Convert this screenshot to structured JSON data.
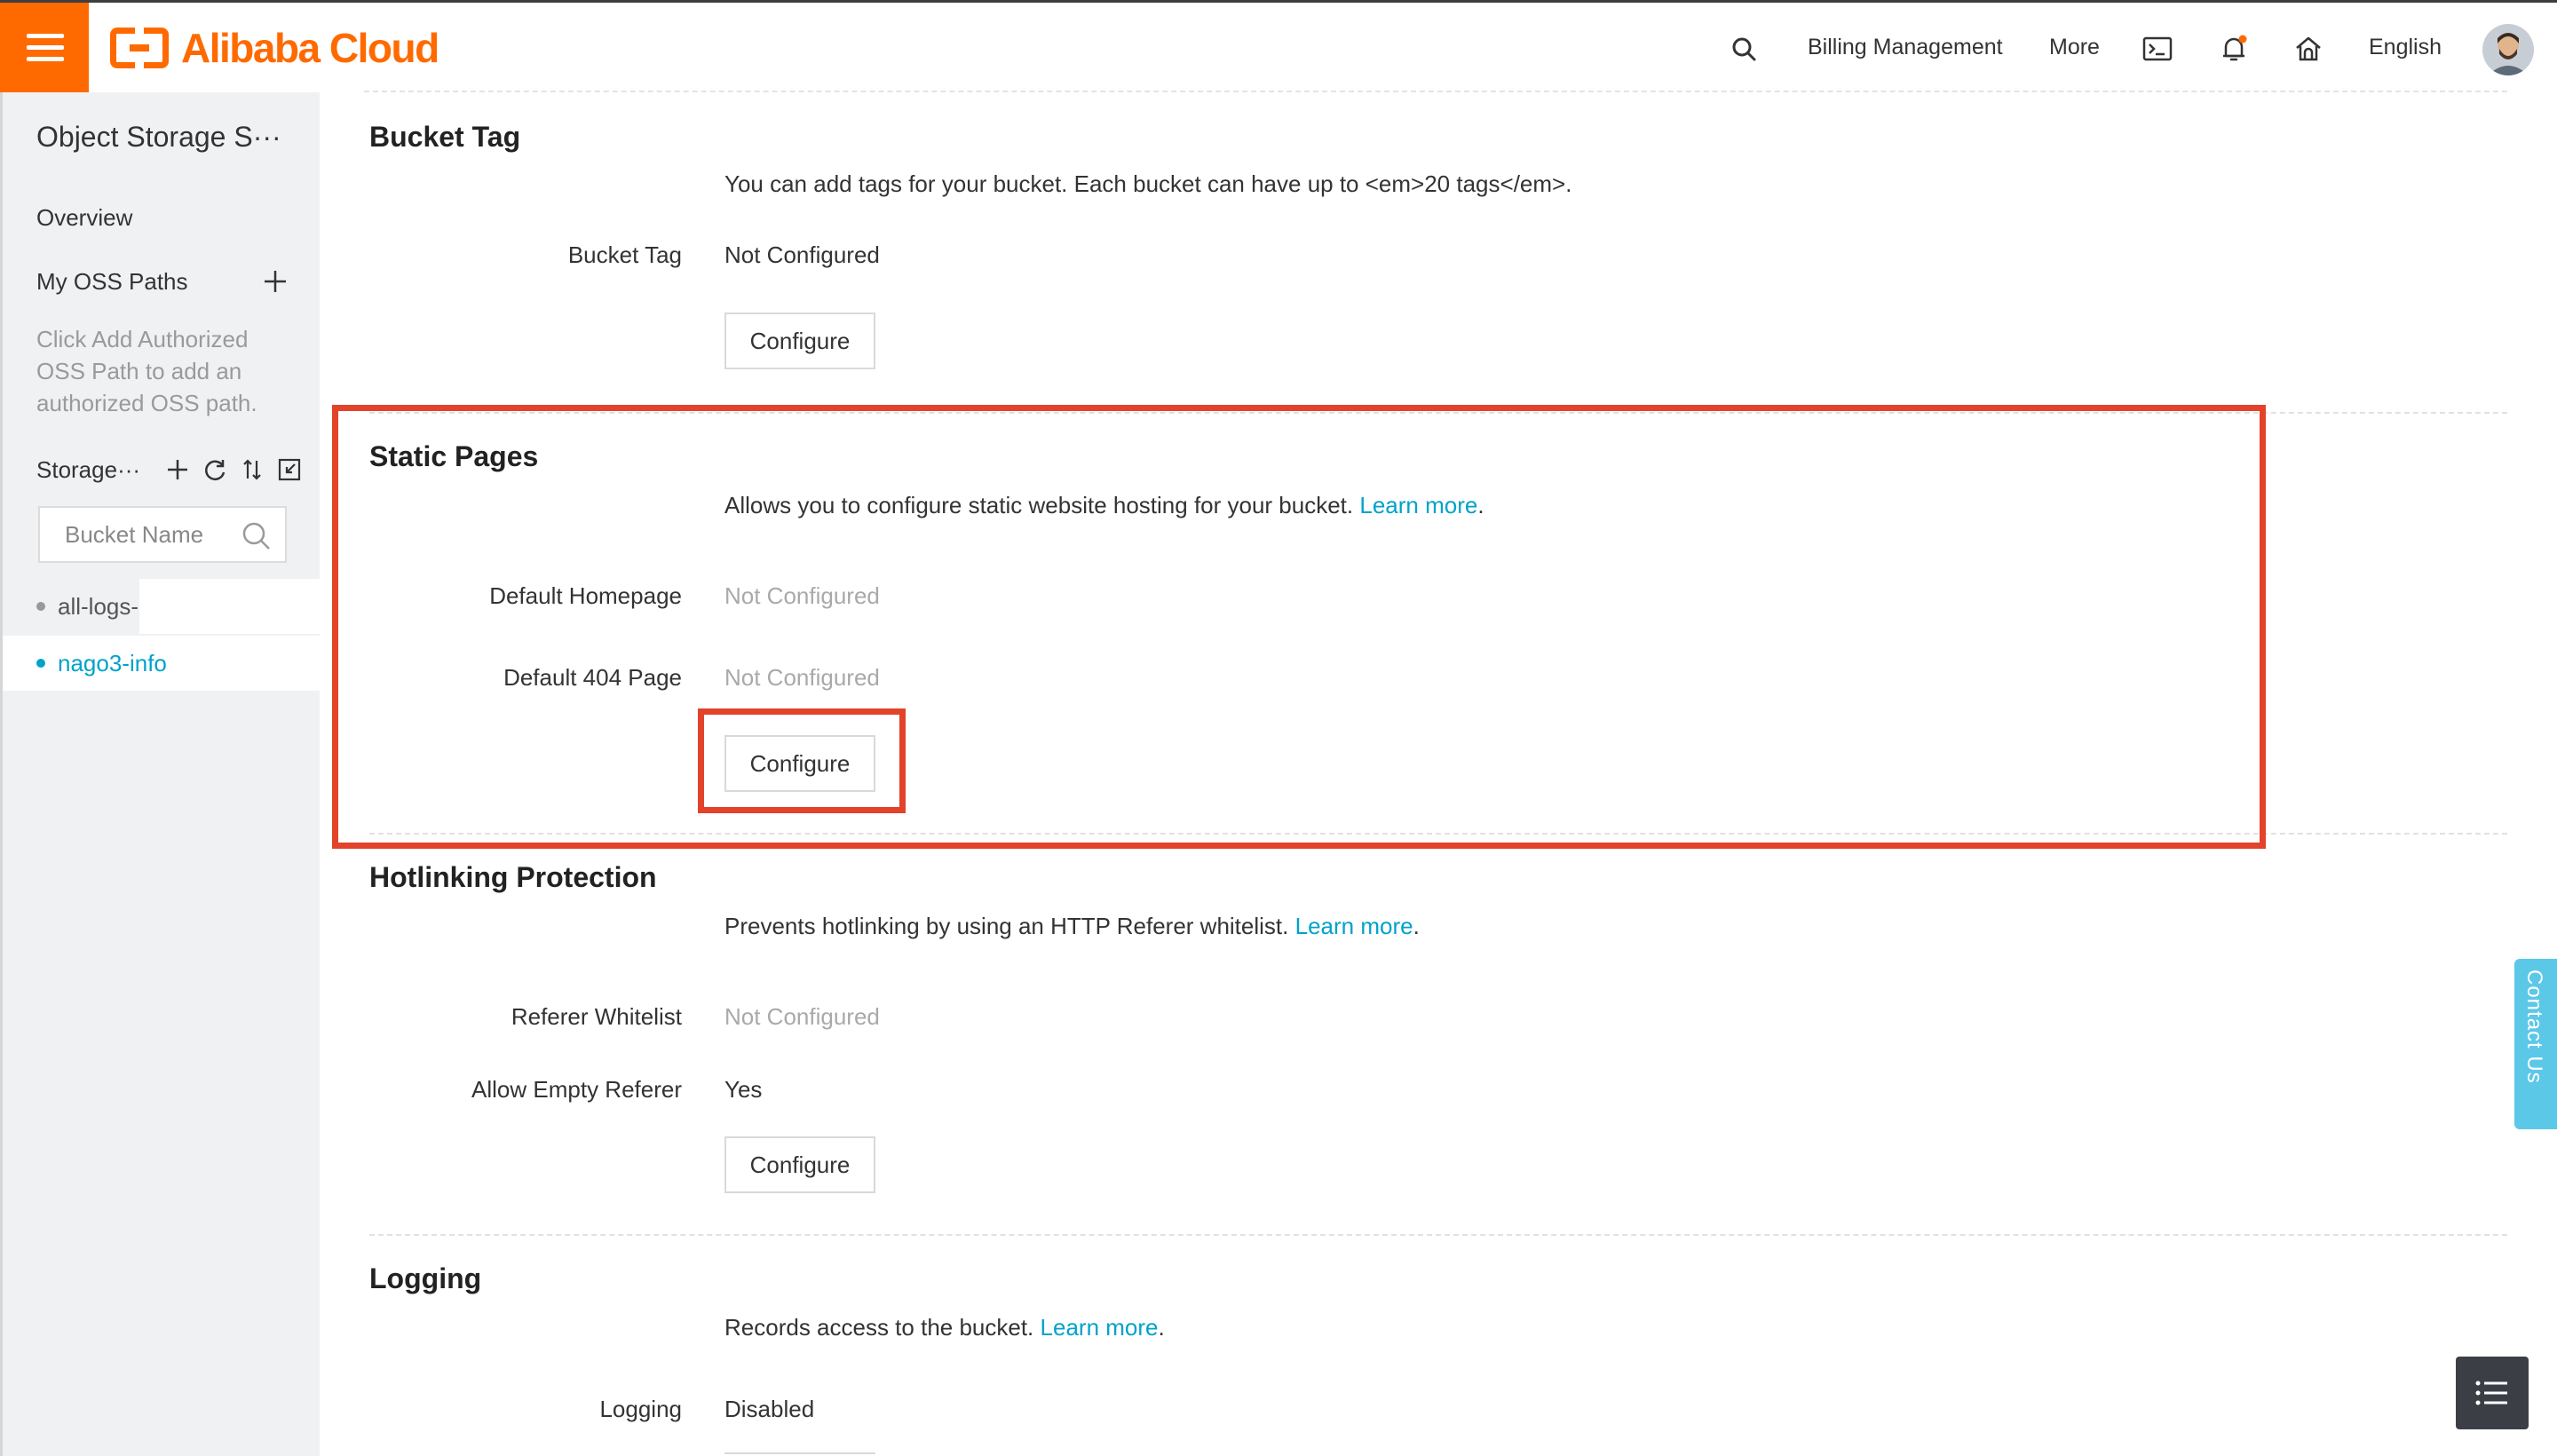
{
  "header": {
    "logo_text": "Alibaba Cloud",
    "nav": {
      "billing": "Billing Management",
      "more": "More",
      "language": "English"
    },
    "icons": [
      "menu-icon",
      "search-icon",
      "terminal-icon",
      "bell-icon",
      "home-icon"
    ],
    "accent_color": "#ff6a00"
  },
  "sidebar": {
    "title": "Object Storage S···",
    "overview": "Overview",
    "my_paths": "My OSS Paths",
    "hint": "Click Add Authorized OSS Path to add an authorized OSS path.",
    "storage_label": "Storage···",
    "search_placeholder": "Bucket Name",
    "buckets": [
      {
        "name": "all-logs-",
        "active": false
      },
      {
        "name": "nago3-info",
        "active": true
      }
    ]
  },
  "sections": {
    "bucket_tag": {
      "title": "Bucket Tag",
      "desc": "You can add tags for your bucket. Each bucket can have up to <em>20 tags</em>.",
      "label": "Bucket Tag",
      "value": "Not Configured",
      "button": "Configure"
    },
    "static_pages": {
      "title": "Static Pages",
      "desc": "Allows you to configure static website hosting for your bucket.",
      "learn_more": "Learn more",
      "homepage_label": "Default Homepage",
      "homepage_value": "Not Configured",
      "page404_label": "Default 404 Page",
      "page404_value": "Not Configured",
      "button": "Configure"
    },
    "hotlinking": {
      "title": "Hotlinking Protection",
      "desc": "Prevents hotlinking by using an HTTP Referer whitelist.",
      "learn_more": "Learn more",
      "whitelist_label": "Referer Whitelist",
      "whitelist_value": "Not Configured",
      "empty_label": "Allow Empty Referer",
      "empty_value": "Yes",
      "button": "Configure"
    },
    "logging": {
      "title": "Logging",
      "desc": "Records access to the bucket.",
      "learn_more": "Learn more",
      "label": "Logging",
      "value": "Disabled"
    }
  },
  "floating": {
    "contact": "Contact Us"
  },
  "colors": {
    "highlight": "#e2432a",
    "link": "#00a2ca"
  }
}
